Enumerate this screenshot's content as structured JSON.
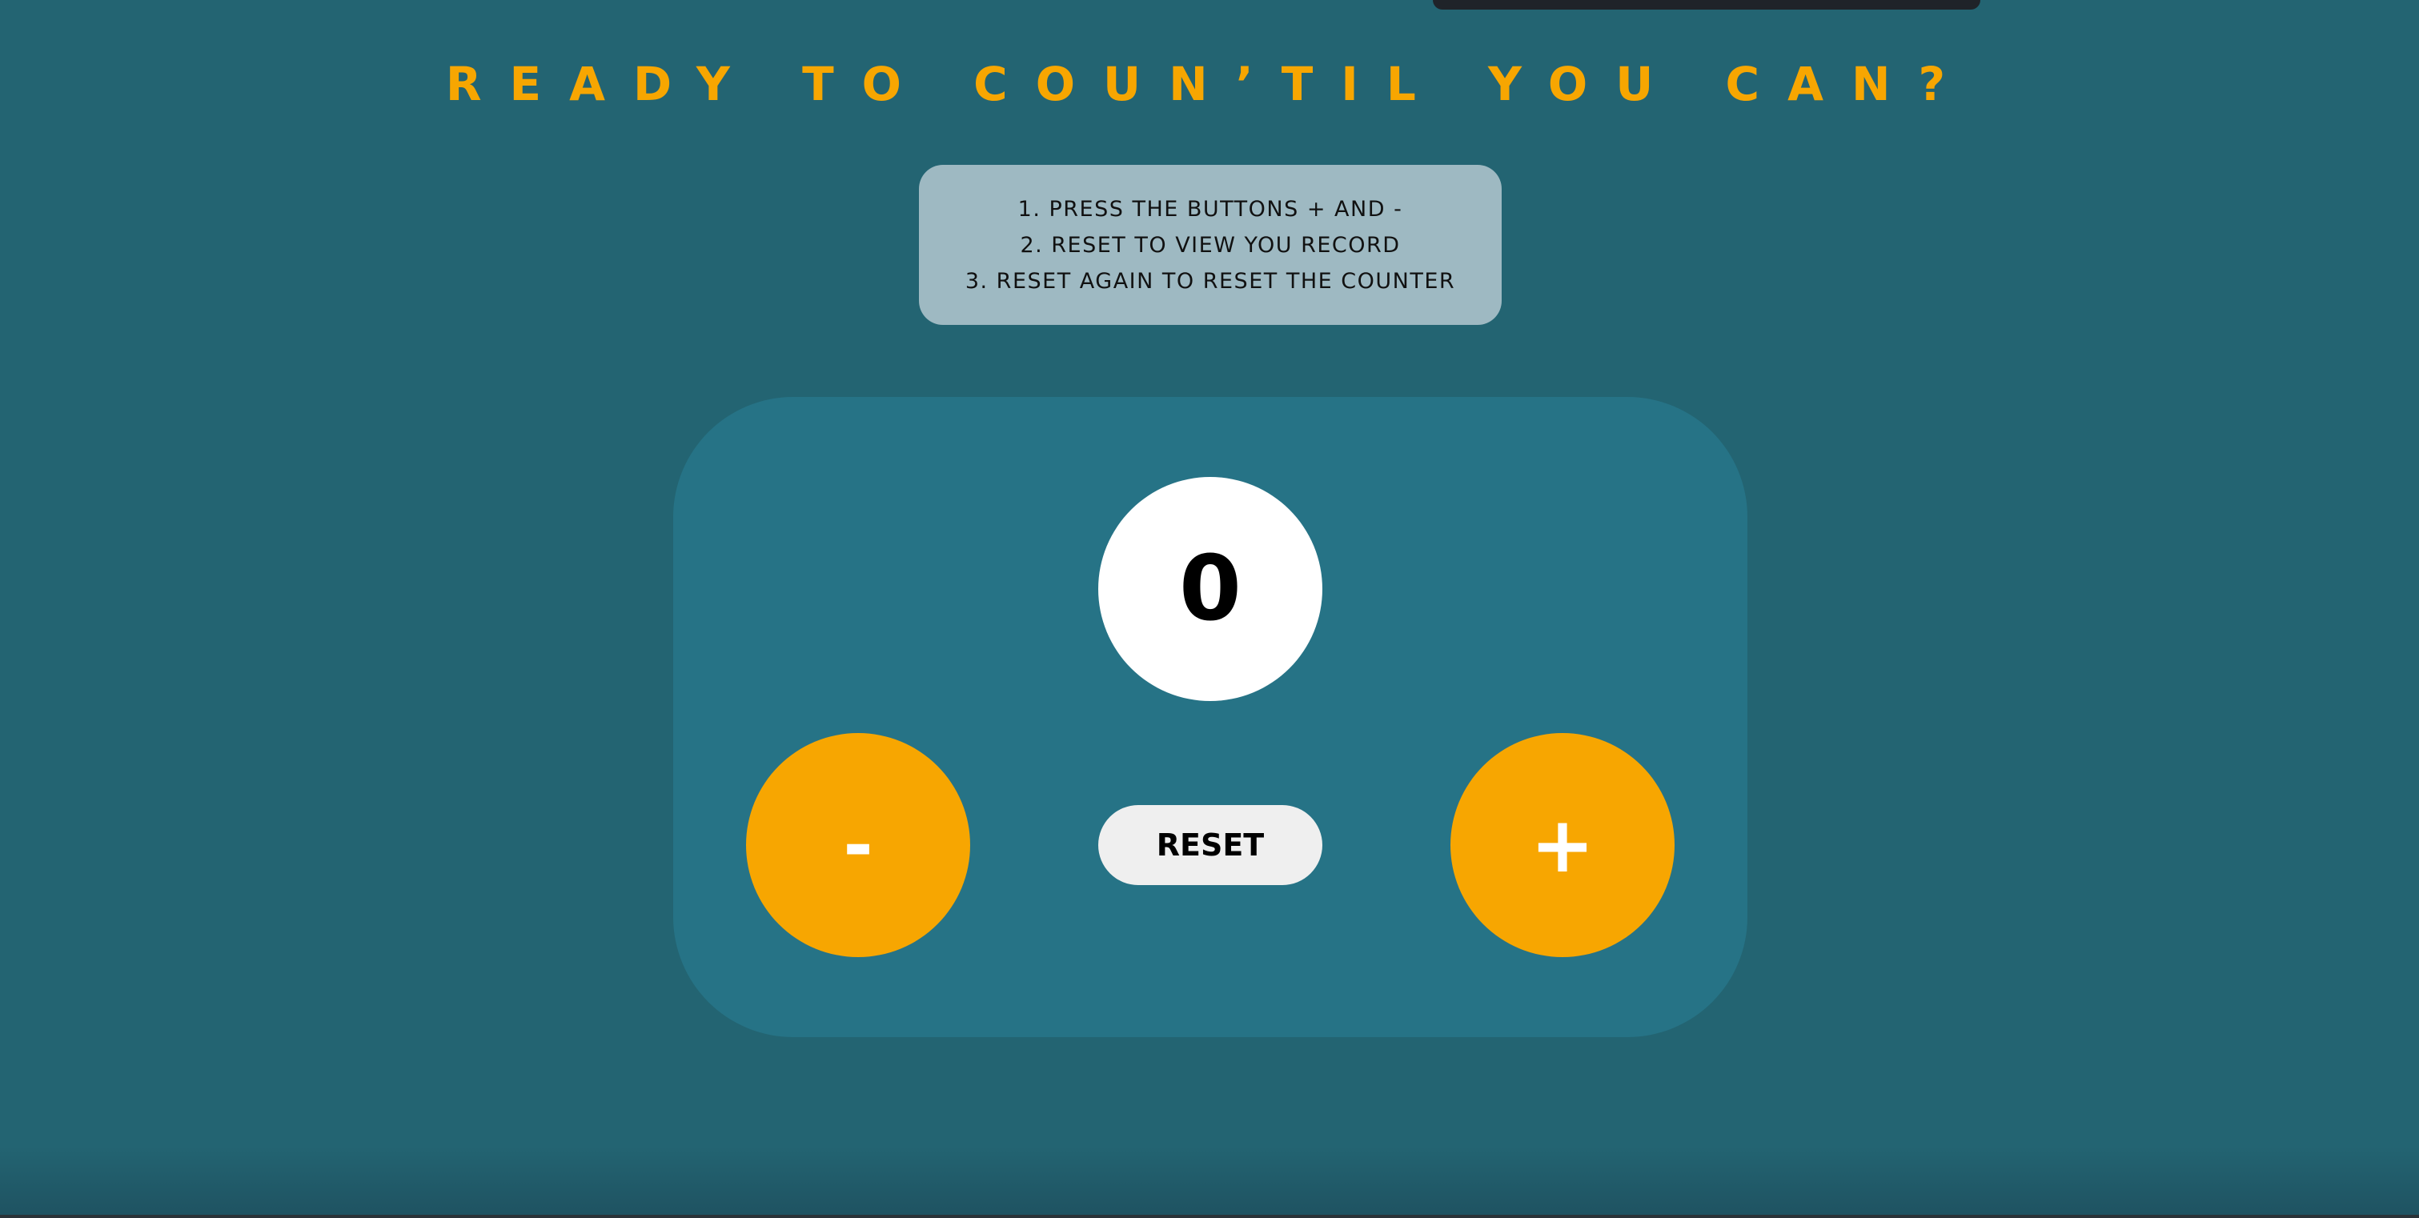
{
  "page": {
    "title": "READY TO COUN’TIL YOU CAN?",
    "colors": {
      "background": "#236472",
      "panel": "#267386",
      "accent": "#f7a601",
      "instructions_bg": "#9eb9c2"
    }
  },
  "instructions": {
    "lines": [
      "1. PRESS THE BUTTONS + AND -",
      "2. RESET TO VIEW YOU RECORD",
      "3. RESET AGAIN TO RESET THE COUNTER"
    ]
  },
  "counter": {
    "value": "0",
    "decrement_label": "-",
    "increment_label": "+",
    "reset_label": "RESET"
  }
}
